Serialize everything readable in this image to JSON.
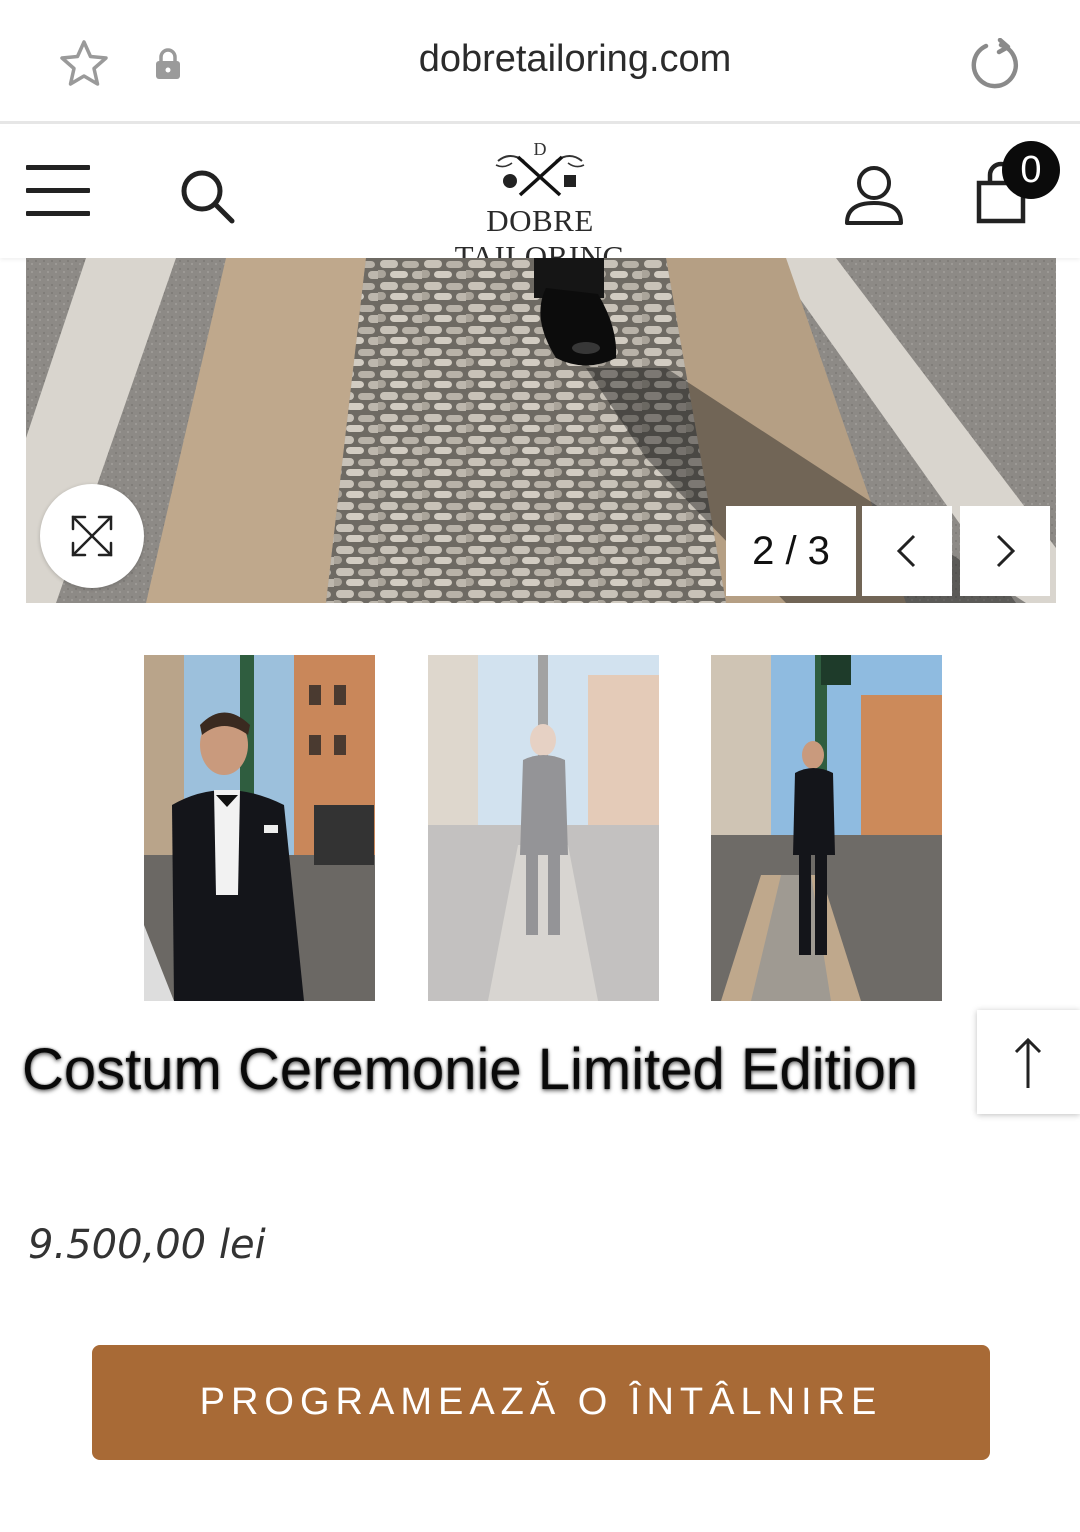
{
  "browser": {
    "url": "dobretailoring.com",
    "star_icon": "star-outline-icon",
    "lock_icon": "lock-icon",
    "reload_icon": "reload-icon"
  },
  "header": {
    "brand": "DOBRE TAILORING",
    "logo_initial": "D",
    "cart_count": "0"
  },
  "gallery": {
    "counter": "2 / 3",
    "current": 2,
    "total": 3
  },
  "product": {
    "title": "Costum Ceremonie  Limited Edition",
    "price": "9.500,00 lei",
    "cta_label": "PROGRAMEAZĂ O ÎNTÂLNIRE"
  },
  "colors": {
    "cta": "#a86a36",
    "text": "#0a0a0a"
  }
}
